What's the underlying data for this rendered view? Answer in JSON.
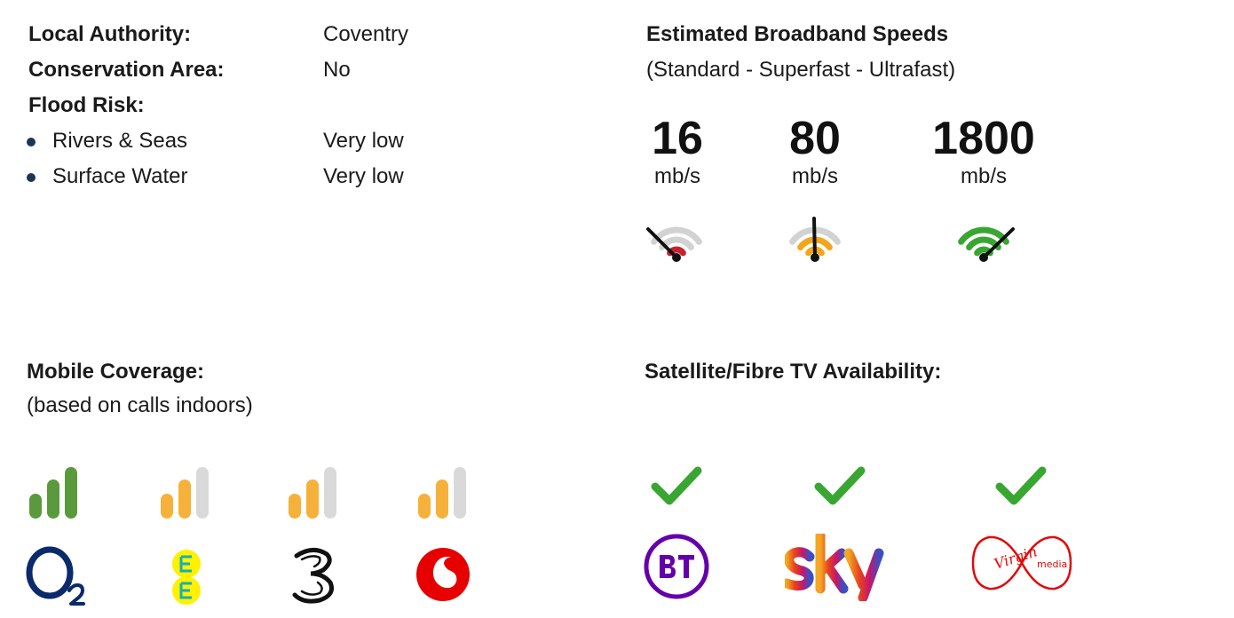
{
  "property": {
    "local_authority_label": "Local Authority:",
    "local_authority_value": "Coventry",
    "conservation_label": "Conservation Area:",
    "conservation_value": "No",
    "flood_label": "Flood Risk:",
    "flood_items": [
      {
        "label": "Rivers & Seas",
        "value": "Very low"
      },
      {
        "label": "Surface Water",
        "value": "Very low"
      }
    ]
  },
  "broadband": {
    "title": "Estimated Broadband Speeds",
    "subtitle": "(Standard - Superfast - Ultrafast)",
    "speeds": [
      {
        "value": "16",
        "unit": "mb/s",
        "color": "#c8222b",
        "icon": "speed-gauge-icon"
      },
      {
        "value": "80",
        "unit": "mb/s",
        "color": "#f2a71b",
        "icon": "speed-gauge-icon"
      },
      {
        "value": "1800",
        "unit": "mb/s",
        "color": "#3aa632",
        "icon": "speed-gauge-icon"
      }
    ]
  },
  "mobile": {
    "title": "Mobile Coverage:",
    "subtitle": "(based on calls indoors)",
    "colors": {
      "full": "#5a9a3c",
      "partial": "#f6b13a",
      "empty": "#d9d9d9"
    },
    "providers": [
      {
        "icon": "o2-logo-icon",
        "signal_bars": 3,
        "level": "full"
      },
      {
        "icon": "ee-logo-icon",
        "signal_bars": 2,
        "level": "partial"
      },
      {
        "icon": "three-logo-icon",
        "signal_bars": 2,
        "level": "partial"
      },
      {
        "icon": "vodafone-logo-icon",
        "signal_bars": 2,
        "level": "partial"
      }
    ]
  },
  "tv": {
    "title": "Satellite/Fibre TV Availability:",
    "check_color": "#3aa632",
    "providers": [
      {
        "icon": "bt-logo-icon",
        "available": true,
        "brand_color": "#6400aa"
      },
      {
        "icon": "sky-logo-icon",
        "available": true,
        "brand_color": "#e6431e"
      },
      {
        "icon": "virgin-media-logo-icon",
        "available": true,
        "brand_color": "#e10a0a"
      }
    ]
  }
}
